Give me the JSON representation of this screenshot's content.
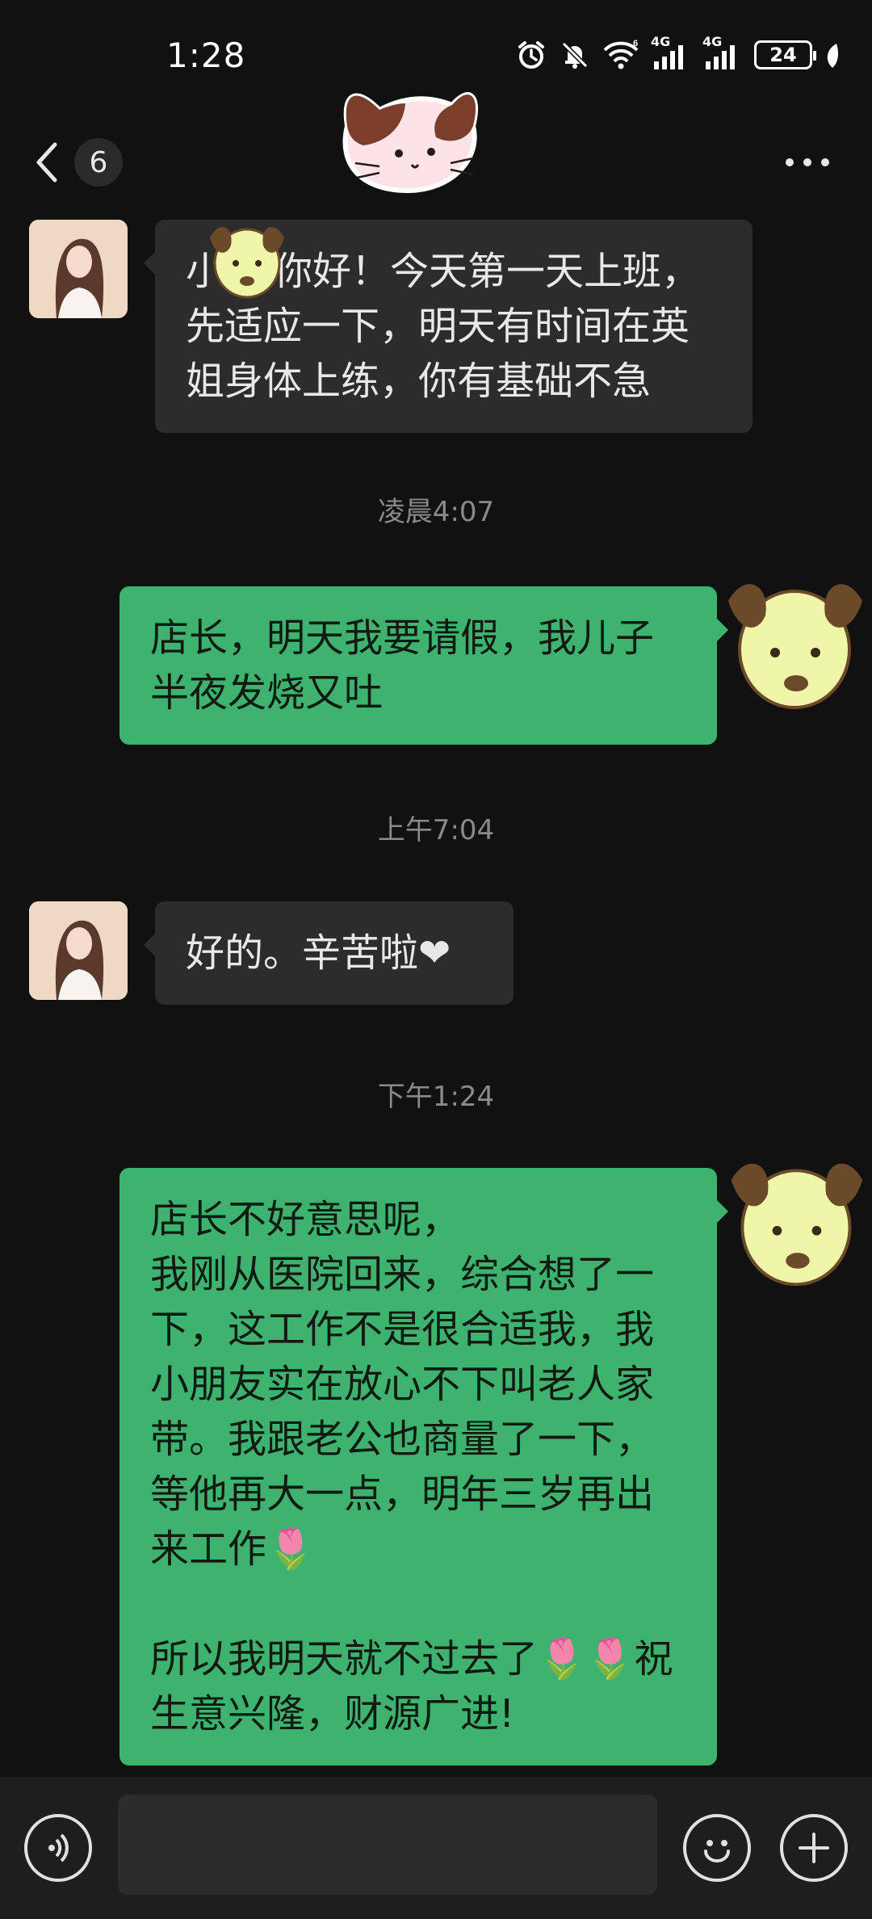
{
  "status_bar": {
    "time": "1:28",
    "network_1": "4G",
    "network_2": "4G",
    "wifi_badge": "6",
    "battery": "24"
  },
  "title_bar": {
    "unread_count": "6"
  },
  "messages": [
    {
      "side": "in",
      "text": "小    你好！今天第一天上班，\n先适应一下，明天有时间在英\n姐身体上练，你有基础不急"
    },
    {
      "type": "time",
      "text": "凌晨4:07"
    },
    {
      "side": "out",
      "text": "店长，明天我要请假，我儿子\n半夜发烧又吐"
    },
    {
      "type": "time",
      "text": "上午7:04"
    },
    {
      "side": "in",
      "text": "好的。辛苦啦❤"
    },
    {
      "type": "time",
      "text": "下午1:24"
    },
    {
      "side": "out",
      "text": "店长不好意思呢，\n我刚从医院回来，综合想了一\n下，这工作不是很合适我，我\n小朋友实在放心不下叫老人家\n带。我跟老公也商量了一下，\n等他再大一点，明年三岁再出\n来工作🌷\n\n所以我明天就不过去了🌷🌷祝\n生意兴隆，财源广进!"
    }
  ],
  "icons": {
    "back": "chevron-left-icon",
    "more": "more-dots-icon",
    "voice": "voice-icon",
    "emoji": "emoji-icon",
    "plus": "plus-icon"
  },
  "colors": {
    "background": "#111111",
    "incoming_bubble": "#2c2c2c",
    "outgoing_bubble": "#3db36f"
  }
}
